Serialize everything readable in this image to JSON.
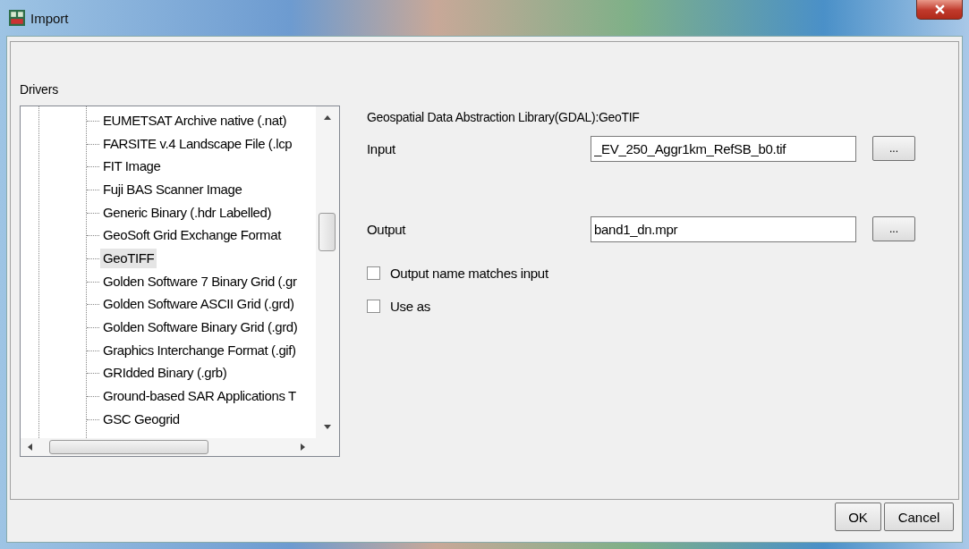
{
  "window": {
    "title": "Import"
  },
  "drivers": {
    "label": "Drivers",
    "items": [
      {
        "label": "EUMETSAT Archive native (.nat)",
        "selected": false
      },
      {
        "label": "FARSITE v.4 Landscape File (.lcp",
        "selected": false
      },
      {
        "label": "FIT Image",
        "selected": false
      },
      {
        "label": "Fuji BAS Scanner Image",
        "selected": false
      },
      {
        "label": "Generic Binary (.hdr Labelled)",
        "selected": false
      },
      {
        "label": "GeoSoft Grid Exchange Format",
        "selected": false
      },
      {
        "label": "GeoTIFF",
        "selected": true
      },
      {
        "label": "Golden Software 7 Binary Grid (.gr",
        "selected": false
      },
      {
        "label": "Golden Software ASCII Grid (.grd)",
        "selected": false
      },
      {
        "label": "Golden Software Binary Grid (.grd)",
        "selected": false
      },
      {
        "label": "Graphics Interchange Format (.gif)",
        "selected": false
      },
      {
        "label": "GRIdded Binary (.grb)",
        "selected": false
      },
      {
        "label": "Ground-based SAR Applications T",
        "selected": false
      },
      {
        "label": "GSC Geogrid",
        "selected": false
      }
    ]
  },
  "details": {
    "driver_name": "Geospatial Data Abstraction Library(GDAL):GeoTIF",
    "input": {
      "label": "Input",
      "value": "_EV_250_Aggr1km_RefSB_b0.tif",
      "browse": "..."
    },
    "output": {
      "label": "Output",
      "value": "band1_dn.mpr",
      "browse": "..."
    },
    "checkboxes": [
      {
        "label": "Output name matches input",
        "checked": false
      },
      {
        "label": "Use as",
        "checked": false
      }
    ]
  },
  "buttons": [
    {
      "label": "OK"
    },
    {
      "label": "Cancel"
    }
  ]
}
